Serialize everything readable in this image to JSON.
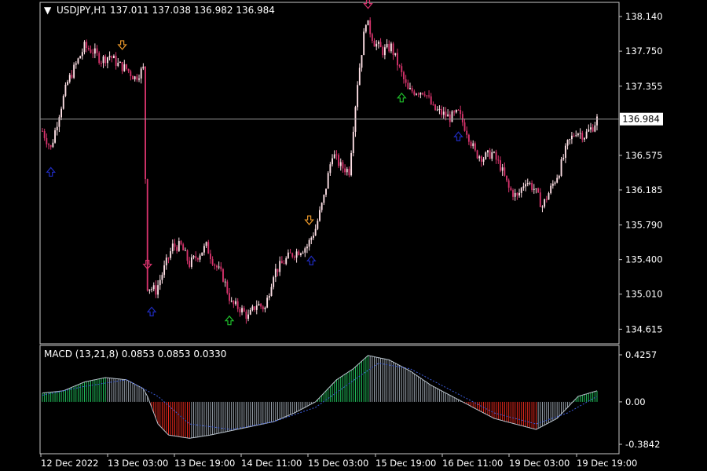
{
  "header": {
    "symbol": "USDJPY,H1",
    "ohlc": "137.011 137.038 136.982 136.984"
  },
  "macd": {
    "label": "MACD (13,21,8) 0.0853 0.0853 0.0330",
    "colors": {
      "up": "#22c55e",
      "down": "#ef2a1f",
      "neutral": "#9aa3ad",
      "main": "#b8c2cc",
      "signal": "#3b5bdb"
    }
  },
  "colors": {
    "background": "#000000",
    "bull_candle": "#ffe0e6",
    "bear_candle": "#d6336c",
    "grid_border": "#c8c8c8",
    "price_line": "#9a9a9a",
    "buy_arrow": "#1f2bbf",
    "buy_arrow_green": "#1fbf2b",
    "sell_arrow": "#e8962a",
    "sell_arrow_red": "#d6336c"
  },
  "chart_data": [
    {
      "type": "candlestick",
      "title": "USDJPY,H1",
      "ylim": [
        134.45,
        138.3
      ],
      "current_price": "136.984",
      "y_ticks": [
        "138.140",
        "137.750",
        "137.355",
        "136.575",
        "136.185",
        "135.790",
        "135.400",
        "135.010",
        "134.615"
      ],
      "y_tick_values": [
        138.14,
        137.75,
        137.355,
        136.575,
        136.185,
        135.79,
        135.4,
        135.01,
        134.615
      ],
      "x_ticks": [
        "12 Dec 2022",
        "13 Dec 03:00",
        "13 Dec 19:00",
        "14 Dec 11:00",
        "15 Dec 03:00",
        "15 Dec 19:00",
        "16 Dec 11:00",
        "19 Dec 03:00",
        "19 Dec 19:00"
      ],
      "anchors": [
        [
          0,
          136.85
        ],
        [
          4,
          136.65
        ],
        [
          8,
          137.05
        ],
        [
          12,
          137.4
        ],
        [
          16,
          137.6
        ],
        [
          20,
          137.8
        ],
        [
          24,
          137.75
        ],
        [
          28,
          137.65
        ],
        [
          32,
          137.7
        ],
        [
          36,
          137.6
        ],
        [
          40,
          137.55
        ],
        [
          44,
          137.45
        ],
        [
          48,
          137.55
        ],
        [
          50,
          135.1
        ],
        [
          54,
          135.05
        ],
        [
          58,
          135.3
        ],
        [
          62,
          135.55
        ],
        [
          66,
          135.55
        ],
        [
          70,
          135.35
        ],
        [
          74,
          135.45
        ],
        [
          78,
          135.55
        ],
        [
          82,
          135.35
        ],
        [
          86,
          135.2
        ],
        [
          90,
          134.9
        ],
        [
          94,
          134.85
        ],
        [
          98,
          134.75
        ],
        [
          102,
          134.9
        ],
        [
          106,
          134.85
        ],
        [
          110,
          135.25
        ],
        [
          114,
          135.35
        ],
        [
          118,
          135.45
        ],
        [
          122,
          135.5
        ],
        [
          126,
          135.55
        ],
        [
          130,
          135.75
        ],
        [
          134,
          136.1
        ],
        [
          138,
          136.6
        ],
        [
          142,
          136.45
        ],
        [
          146,
          136.4
        ],
        [
          150,
          137.4
        ],
        [
          154,
          138.1
        ],
        [
          158,
          137.85
        ],
        [
          162,
          137.75
        ],
        [
          166,
          137.8
        ],
        [
          170,
          137.55
        ],
        [
          174,
          137.3
        ],
        [
          178,
          137.3
        ],
        [
          182,
          137.3
        ],
        [
          186,
          137.1
        ],
        [
          190,
          137.05
        ],
        [
          194,
          137.0
        ],
        [
          198,
          137.05
        ],
        [
          202,
          136.85
        ],
        [
          206,
          136.6
        ],
        [
          210,
          136.55
        ],
        [
          214,
          136.6
        ],
        [
          218,
          136.45
        ],
        [
          222,
          136.2
        ],
        [
          226,
          136.1
        ],
        [
          230,
          136.3
        ],
        [
          234,
          136.2
        ],
        [
          238,
          136.0
        ],
        [
          242,
          136.2
        ],
        [
          246,
          136.4
        ],
        [
          250,
          136.7
        ],
        [
          254,
          136.85
        ],
        [
          258,
          136.8
        ],
        [
          262,
          136.9
        ],
        [
          264,
          136.984
        ]
      ],
      "buy_signals": [
        4,
        52,
        89,
        128,
        171,
        198
      ],
      "buy_signal_colors": [
        "blue",
        "blue",
        "green",
        "blue",
        "green"
      ],
      "sell_signals": [
        38,
        50,
        127,
        155
      ],
      "sell_signal_colors": [
        "orange",
        "red",
        "orange",
        "red"
      ]
    },
    {
      "type": "histogram",
      "title": "MACD (13,21,8)",
      "ylim": [
        -0.3842,
        0.4257
      ],
      "y_ticks": [
        "0.4257",
        "0.00",
        "-0.3842"
      ],
      "y_tick_values": [
        0.4257,
        0.0,
        -0.3842
      ],
      "hist_anchors": [
        [
          0,
          0.08
        ],
        [
          10,
          0.1
        ],
        [
          20,
          0.18
        ],
        [
          30,
          0.22
        ],
        [
          40,
          0.2
        ],
        [
          48,
          0.12
        ],
        [
          50,
          0.05
        ],
        [
          55,
          -0.2
        ],
        [
          60,
          -0.3
        ],
        [
          70,
          -0.33
        ],
        [
          80,
          -0.3
        ],
        [
          90,
          -0.26
        ],
        [
          100,
          -0.22
        ],
        [
          110,
          -0.18
        ],
        [
          120,
          -0.1
        ],
        [
          130,
          0.0
        ],
        [
          140,
          0.2
        ],
        [
          148,
          0.3
        ],
        [
          155,
          0.42
        ],
        [
          165,
          0.38
        ],
        [
          175,
          0.28
        ],
        [
          185,
          0.15
        ],
        [
          195,
          0.05
        ],
        [
          205,
          -0.05
        ],
        [
          215,
          -0.15
        ],
        [
          225,
          -0.2
        ],
        [
          235,
          -0.25
        ],
        [
          245,
          -0.15
        ],
        [
          255,
          0.05
        ],
        [
          264,
          0.1
        ]
      ],
      "signal_anchors": [
        [
          0,
          0.06
        ],
        [
          20,
          0.14
        ],
        [
          40,
          0.2
        ],
        [
          55,
          0.05
        ],
        [
          70,
          -0.2
        ],
        [
          90,
          -0.25
        ],
        [
          110,
          -0.18
        ],
        [
          130,
          -0.05
        ],
        [
          150,
          0.22
        ],
        [
          160,
          0.35
        ],
        [
          175,
          0.3
        ],
        [
          195,
          0.1
        ],
        [
          215,
          -0.1
        ],
        [
          235,
          -0.2
        ],
        [
          250,
          -0.1
        ],
        [
          264,
          0.05
        ]
      ]
    }
  ]
}
